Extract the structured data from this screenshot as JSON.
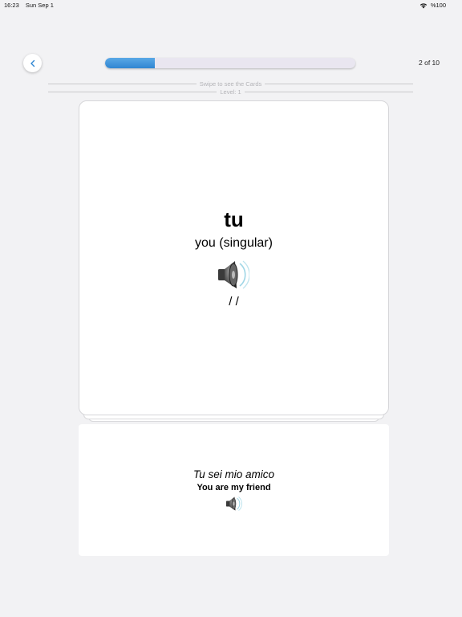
{
  "status_bar": {
    "time": "16:23",
    "date": "Sun Sep 1",
    "battery": "%100",
    "wifi_icon": "wifi-icon"
  },
  "header": {
    "back_icon": "chevron-left-icon",
    "progress_fraction": 0.2,
    "progress_text": "2 of 10"
  },
  "hints": {
    "swipe": "Swipe to see the Cards",
    "level": "Level: 1"
  },
  "card": {
    "word": "tu",
    "translation": "you (singular)",
    "speaker_icon": "speaker-icon",
    "phonetic": "/ /"
  },
  "example": {
    "sentence": "Tu sei mio amico",
    "translation": "You are my friend",
    "speaker_icon": "speaker-icon"
  },
  "colors": {
    "accent": "#2f86d2",
    "background": "#f2f2f4"
  }
}
